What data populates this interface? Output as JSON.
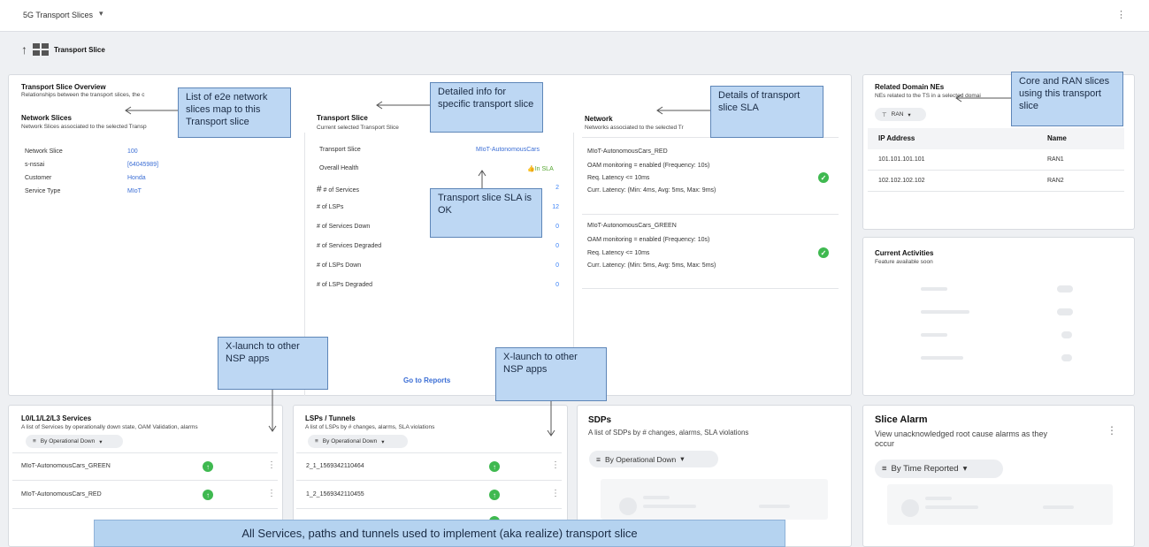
{
  "topbar": {
    "title": "5G Transport Slices",
    "caret": "▾",
    "kebab": "⋮"
  },
  "breadcrumb": {
    "label": "Transport Slice"
  },
  "overview": {
    "title": "Transport Slice Overview",
    "subtitle": "Relationships between the transport slices, the c",
    "ns_title": "Network Slices",
    "ns_subtitle": "Network Slices associated to the selected Transp",
    "rows": [
      {
        "label": "Network Slice",
        "value": "100"
      },
      {
        "label": "s-nssai",
        "value": "[64045989]"
      },
      {
        "label": "Customer",
        "value": "Honda"
      },
      {
        "label": "Service Type",
        "value": "MIoT"
      }
    ]
  },
  "tslice": {
    "title": "Transport Slice",
    "subtitle": "Current selected Transport Slice",
    "name_label": "Transport Slice",
    "name_value": "MIoT-AutonomousCars",
    "health_label": "Overall Health",
    "health_value": "In SLA",
    "stats": [
      {
        "label": "# of Services",
        "value": "2"
      },
      {
        "label": "# of LSPs",
        "value": "12"
      },
      {
        "label": "# of Services Down",
        "value": "0"
      },
      {
        "label": "# of Services Degraded",
        "value": "0"
      },
      {
        "label": "# of LSPs Down",
        "value": "0"
      },
      {
        "label": "# of LSPs Degraded",
        "value": "0"
      }
    ],
    "reports_link": "Go to Reports"
  },
  "network": {
    "title": "Network",
    "subtitle": "Networks associated to the selected Tr",
    "items": [
      {
        "name": "MIoT-AutonomousCars_RED",
        "oam": "OAM monitoring = enabled (Frequency: 10s)",
        "req": "Req. Latency <= 10ms",
        "curr": "Curr. Latency: (Min: 4ms, Avg: 5ms, Max: 9ms)"
      },
      {
        "name": "MIoT-AutonomousCars_GREEN",
        "oam": "OAM monitoring = enabled (Frequency: 10s)",
        "req": "Req. Latency <= 10ms",
        "curr": "Curr. Latency: (Min: 5ms, Avg: 5ms, Max: 5ms)"
      }
    ]
  },
  "related": {
    "title": "Related Domain NEs",
    "subtitle": "NEs related to the TS in a selected domai",
    "filter": "RAN",
    "col_ip": "IP Address",
    "col_name": "Name",
    "rows": [
      {
        "ip": "101.101.101.101",
        "name": "RAN1"
      },
      {
        "ip": "102.102.102.102",
        "name": "RAN2"
      }
    ]
  },
  "activities": {
    "title": "Current Activities",
    "subtitle": "Feature available soon"
  },
  "services": {
    "title": "L0/L1/L2/L3 Services",
    "subtitle": "A list of Services by operationally down state, OAM Validation, alarms",
    "sort": "By Operational Down",
    "rows": [
      "MIoT-AutonomousCars_GREEN",
      "MIoT-AutonomousCars_RED"
    ]
  },
  "lsps": {
    "title": "LSPs / Tunnels",
    "subtitle": "A list of LSPs by # changes, alarms, SLA violations",
    "sort": "By Operational Down",
    "rows": [
      "2_1_1569342110464",
      "1_2_1569342110455"
    ]
  },
  "sdps": {
    "title": "SDPs",
    "subtitle": "A list of SDPs by # changes, alarms, SLA violations",
    "sort": "By Operational Down"
  },
  "alarm": {
    "title": "Slice Alarm",
    "subtitle": "View unacknowledged root cause alarms as they occur",
    "sort": "By Time Reported"
  },
  "callouts": {
    "e2e": "List of e2e network slices map to this Transport slice",
    "detailed": "Detailed info for specific transport slice",
    "sla_details": "Details of transport slice SLA",
    "core_ran": "Core and RAN slices using this transport slice",
    "sla_ok": "Transport slice SLA is OK",
    "xlaunch1": "X-launch to other NSP apps",
    "xlaunch2": "X-launch to other NSP apps"
  },
  "banner": "All Services, paths and tunnels used to implement (aka realize) transport slice",
  "colors": {
    "accent": "#3b6ed5",
    "callout": "#bdd7f3",
    "ok": "#3fb950"
  }
}
